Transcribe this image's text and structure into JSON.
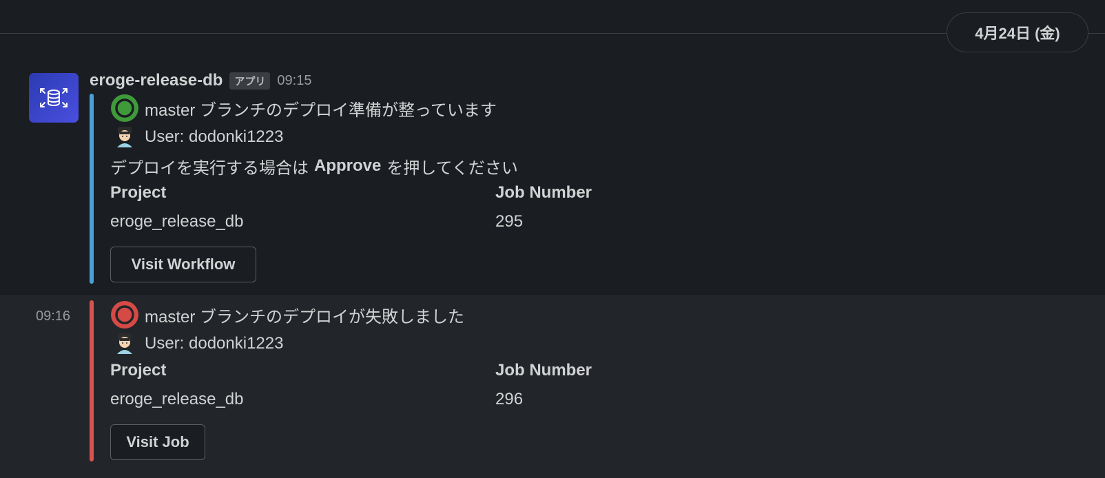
{
  "date_divider": {
    "label": "4月24日 (金)"
  },
  "messages": [
    {
      "sender": "eroge-release-db",
      "badge": "アプリ",
      "time": "09:15",
      "bar_color": "#4a9fd8",
      "status_icon": "circleci-success-icon",
      "status_text": "master ブランチのデプロイ準備が整っています",
      "user_text": "User: dodonki1223",
      "instruction_prefix": "デプロイを実行する場合は",
      "instruction_bold": "Approve",
      "instruction_suffix": "を押してください",
      "fields": {
        "project_label": "Project",
        "project_value": "eroge_release_db",
        "job_label": "Job Number",
        "job_value": "295"
      },
      "button_label": "Visit Workflow"
    },
    {
      "time": "09:16",
      "bar_color": "#d9534f",
      "status_icon": "circleci-failed-icon",
      "status_text": "master ブランチのデプロイが失敗しました",
      "user_text": "User: dodonki1223",
      "fields": {
        "project_label": "Project",
        "project_value": "eroge_release_db",
        "job_label": "Job Number",
        "job_value": "296"
      },
      "button_label": "Visit Job"
    }
  ]
}
